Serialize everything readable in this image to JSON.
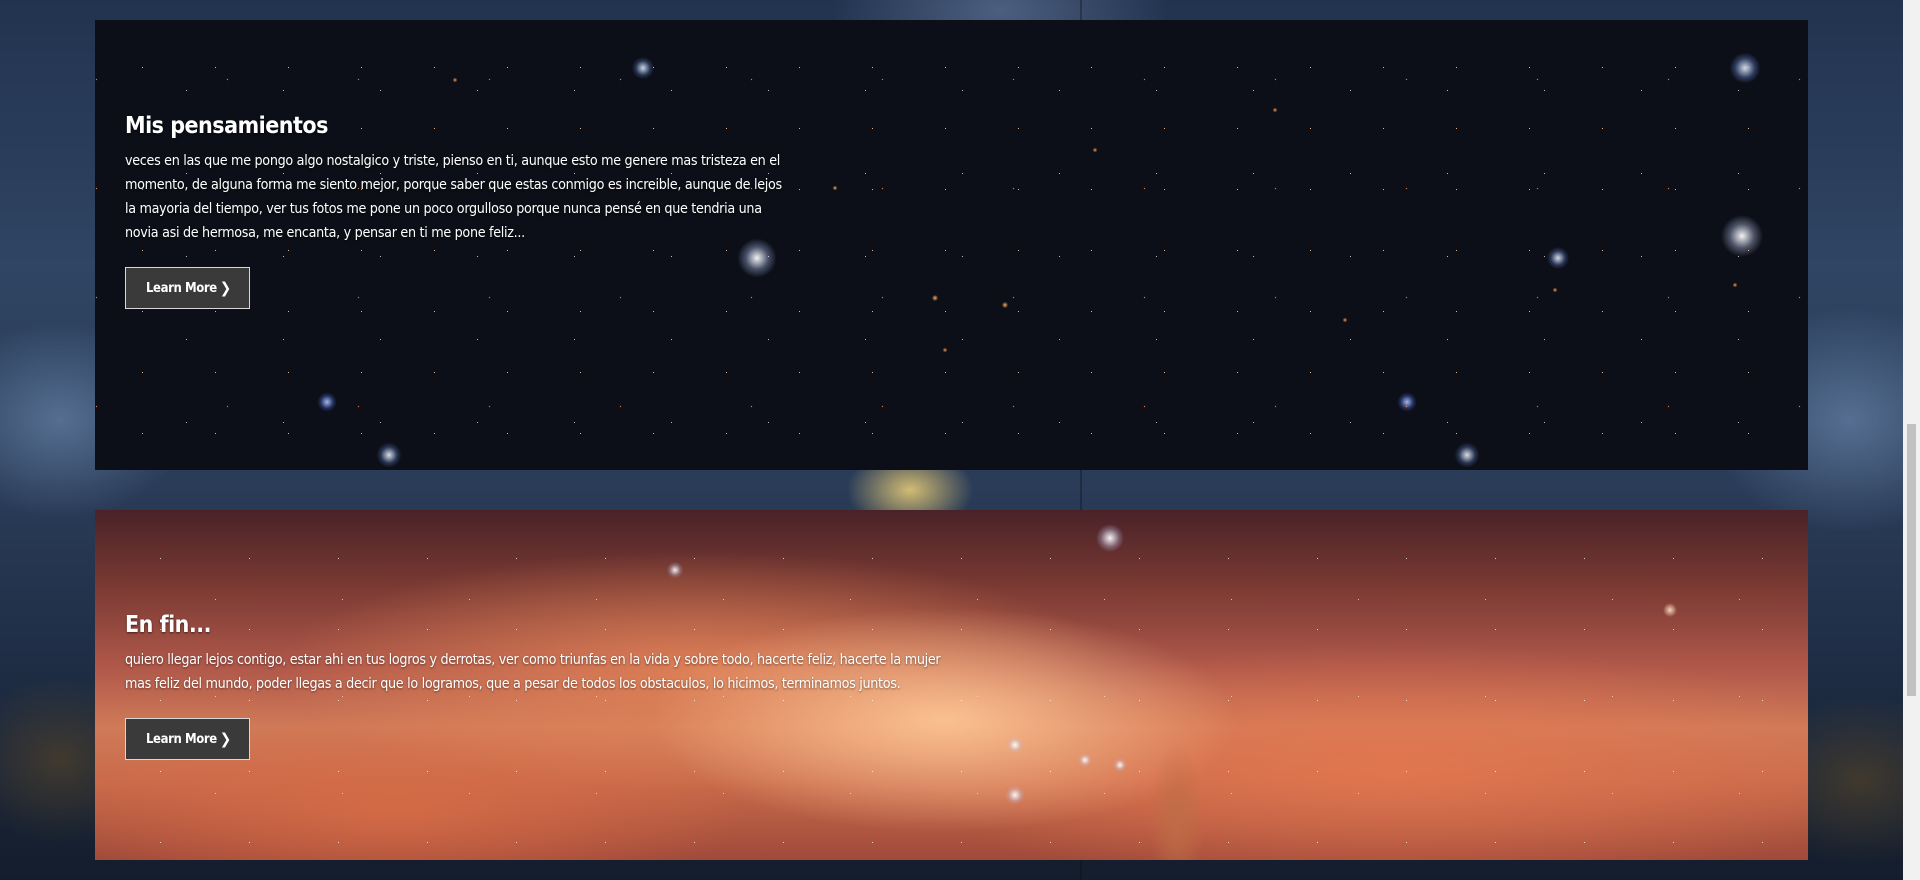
{
  "sections": [
    {
      "title": "Mis pensamientos",
      "body": "veces en las que me pongo algo nostalgico y triste, pienso en ti, aunque esto me genere mas tristeza en el momento, de alguna forma me siento mejor, porque saber que estas conmigo es increible, aunque de lejos la mayoria del tiempo, ver tus fotos me pone un poco orgulloso porque nunca pensé en que tendria una novia asi de hermosa, me encanta, y pensar en ti me pone feliz...",
      "button_label": "Learn More"
    },
    {
      "title": "En fin...",
      "body": "quiero llegar lejos contigo, estar ahi en tus logros y derrotas, ver como triunfas en la vida y sobre todo, hacerte feliz, hacerte la mujer mas feliz del mundo, poder llegas a decir que lo logramos, que a pesar de todos los obstaculos, lo hicimos, terminamos juntos.",
      "button_label": "Learn More"
    }
  ],
  "icons": {
    "button_chevron": "chevron-right-icon"
  },
  "scroll_position": 0.62
}
